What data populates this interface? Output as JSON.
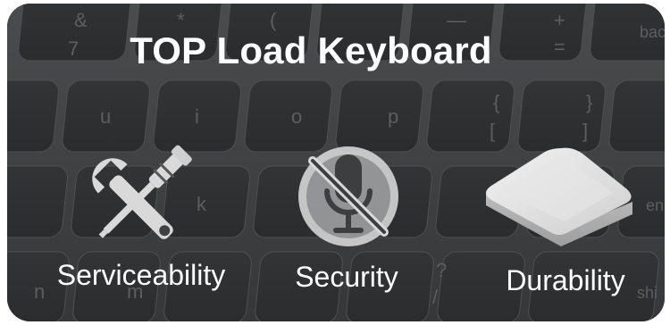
{
  "banner": {
    "title": "TOP Load Keyboard",
    "background": {
      "description_keys": [
        "&",
        "7",
        "*",
        "(",
        "_",
        "+",
        "=",
        "bac",
        "u",
        "i",
        "o",
        "p",
        "{",
        "[",
        "}",
        "]",
        "k",
        "en",
        ">",
        "?",
        "/",
        "n",
        "m",
        "shi"
      ]
    },
    "features": [
      {
        "label": "Serviceability",
        "icon": "wrench-screwdriver-icon"
      },
      {
        "label": "Security",
        "icon": "muted-microphone-icon"
      },
      {
        "label": "Durability",
        "icon": "keycap-icon"
      }
    ],
    "colors": {
      "background": "#3f4142",
      "key": "#2f3132",
      "text": "#ffffff",
      "icon": "#d9d9d9"
    }
  }
}
